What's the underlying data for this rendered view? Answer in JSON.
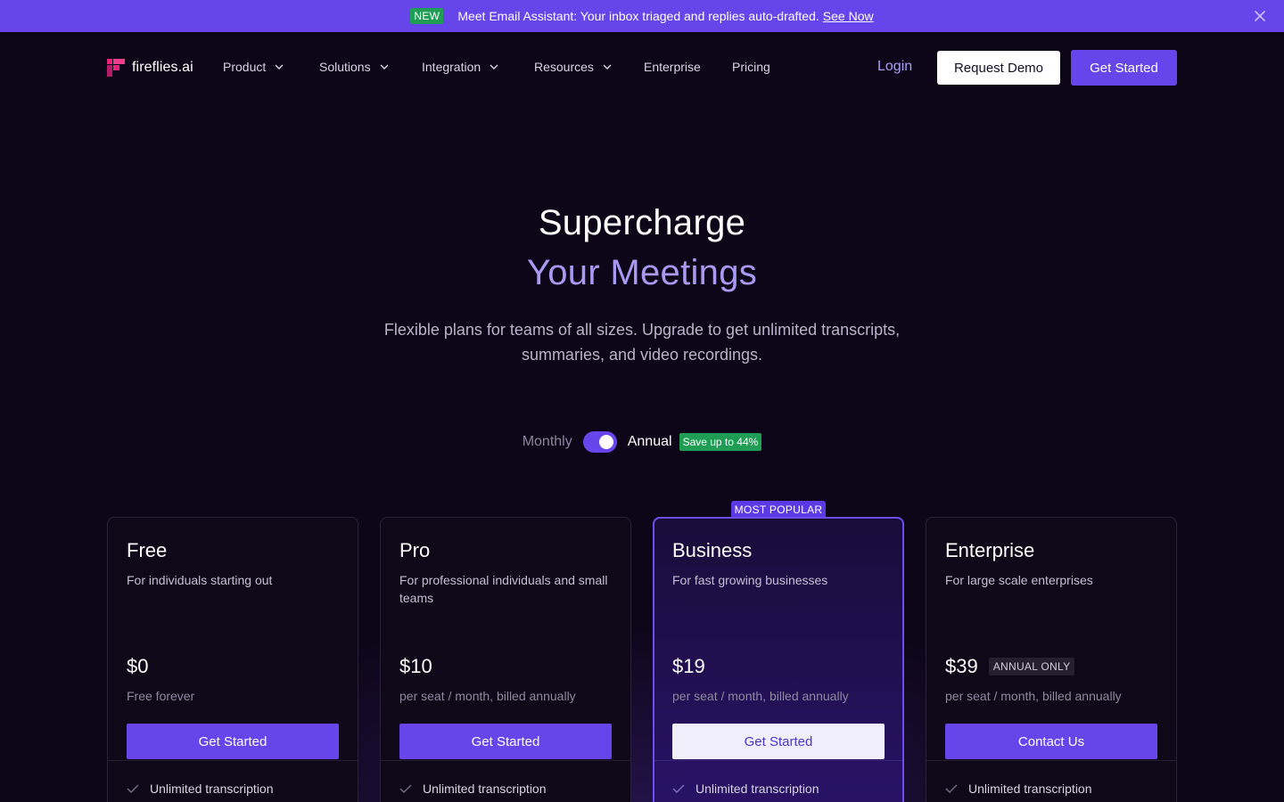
{
  "announcement": {
    "badge": "NEW",
    "text": "Meet Email Assistant: Your inbox triaged and replies auto-drafted.",
    "link": "See Now"
  },
  "nav": {
    "logo": "fireflies.ai",
    "items": [
      "Product",
      "Solutions",
      "Integration",
      "Resources",
      "Enterprise",
      "Pricing"
    ],
    "login": "Login",
    "request_demo": "Request Demo",
    "get_started": "Get Started"
  },
  "hero": {
    "title_line1": "Supercharge",
    "title_line2": "Your Meetings",
    "subtitle": "Flexible plans for teams of all sizes. Upgrade to get unlimited transcripts, summaries, and video recordings."
  },
  "billing": {
    "monthly": "Monthly",
    "annual": "Annual",
    "save_badge": "Save up to 44%",
    "annual_selected": true
  },
  "plans": [
    {
      "name": "Free",
      "description": "For individuals starting out",
      "price": "$0",
      "per": "Free forever",
      "button": "Get Started",
      "feature": "Unlimited transcription"
    },
    {
      "name": "Pro",
      "description": "For professional individuals and small teams",
      "price": "$10",
      "per": "per seat / month, billed annually",
      "button": "Get Started",
      "feature": "Unlimited transcription"
    },
    {
      "name": "Business",
      "description": "For fast growing businesses",
      "price": "$19",
      "per": "per seat / month, billed annually",
      "button": "Get Started",
      "feature": "Unlimited transcription",
      "tag": "MOST POPULAR"
    },
    {
      "name": "Enterprise",
      "description": "For large scale enterprises",
      "price": "$39",
      "badge": "ANNUAL ONLY",
      "per": "per seat / month, billed annually",
      "button": "Contact Us",
      "feature": "Unlimited transcription"
    }
  ],
  "colors": {
    "accent": "#6645ea",
    "background": "#0d0618",
    "highlight_text": "#a89af2",
    "success": "#1f9d55"
  }
}
